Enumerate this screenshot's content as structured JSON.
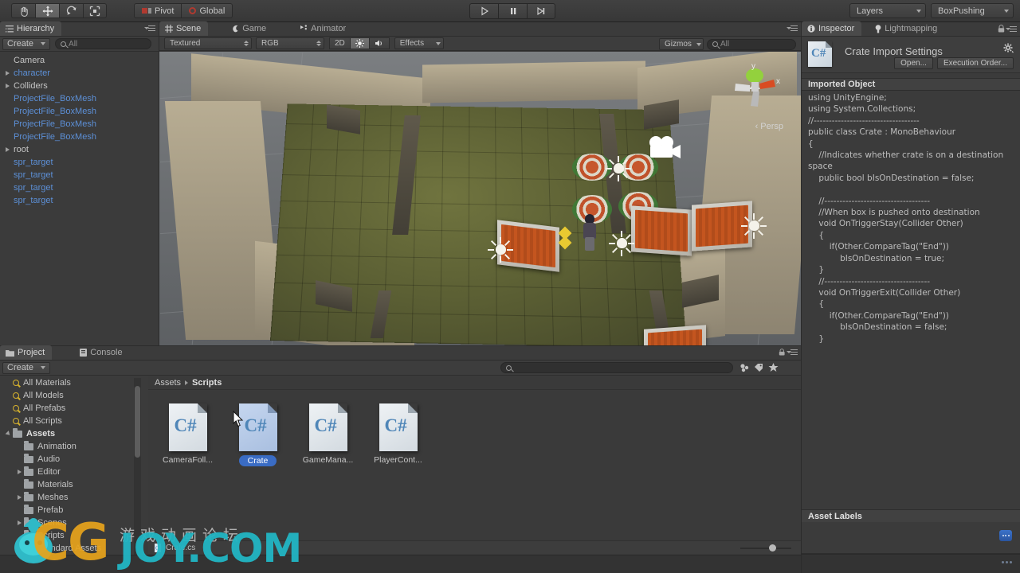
{
  "toolbar": {
    "tools": [
      {
        "name": "hand-tool",
        "icon": "hand",
        "active": false
      },
      {
        "name": "move-tool",
        "icon": "move",
        "active": true
      },
      {
        "name": "rotate-tool",
        "icon": "rotate",
        "active": false
      },
      {
        "name": "scale-tool",
        "icon": "scale",
        "active": false
      }
    ],
    "pivot_label": "Pivot",
    "global_label": "Global",
    "play_label": "play",
    "pause_label": "pause",
    "step_label": "step",
    "layers_label": "Layers",
    "layout_label": "BoxPushing"
  },
  "hierarchy": {
    "tab_label": "Hierarchy",
    "create_label": "Create",
    "search_placeholder": "All",
    "items": [
      {
        "label": "Camera",
        "expandable": false,
        "color": "gray"
      },
      {
        "label": "character",
        "expandable": true,
        "color": "blue"
      },
      {
        "label": "Colliders",
        "expandable": true,
        "color": "gray"
      },
      {
        "label": "ProjectFile_BoxMesh",
        "expandable": false,
        "color": "blue"
      },
      {
        "label": "ProjectFile_BoxMesh",
        "expandable": false,
        "color": "blue"
      },
      {
        "label": "ProjectFile_BoxMesh",
        "expandable": false,
        "color": "blue"
      },
      {
        "label": "ProjectFile_BoxMesh",
        "expandable": false,
        "color": "blue"
      },
      {
        "label": "root",
        "expandable": true,
        "color": "gray"
      },
      {
        "label": "spr_target",
        "expandable": false,
        "color": "blue"
      },
      {
        "label": "spr_target",
        "expandable": false,
        "color": "blue"
      },
      {
        "label": "spr_target",
        "expandable": false,
        "color": "blue"
      },
      {
        "label": "spr_target",
        "expandable": false,
        "color": "blue"
      }
    ]
  },
  "scene": {
    "tabs": [
      {
        "label": "Scene",
        "icon": "grid-icon",
        "active": true
      },
      {
        "label": "Game",
        "icon": "gamepad-icon",
        "active": false
      },
      {
        "label": "Animator",
        "icon": "animator-icon",
        "active": false
      }
    ],
    "draw_mode": "Textured",
    "color_mode": "RGB",
    "mode_2d": "2D",
    "lighting_icon": "sun-icon",
    "audio_icon": "speaker-icon",
    "effects_label": "Effects",
    "gizmos_label": "Gizmos",
    "gizmo_search_placeholder": "All",
    "axis_x": "x",
    "axis_y": "y",
    "projection_label": "Persp"
  },
  "inspector": {
    "tabs": [
      {
        "label": "Inspector",
        "icon": "info-icon",
        "active": true
      },
      {
        "label": "Lightmapping",
        "icon": "bulb-icon",
        "active": false
      }
    ],
    "title": "Crate Import Settings",
    "open_label": "Open...",
    "execution_order_label": "Execution Order...",
    "imported_object_label": "Imported Object",
    "source_code": "using UnityEngine;\nusing System.Collections;\n//-----------------------------------\npublic class Crate : MonoBehaviour\n{\n    //Indicates whether crate is on a destination space\n    public bool bIsOnDestination = false;\n\n    //-----------------------------------\n    //When box is pushed onto destination\n    void OnTriggerStay(Collider Other)\n    {\n        if(Other.CompareTag(\"End\"))\n            bIsOnDestination = true;\n    }\n    //-----------------------------------\n    void OnTriggerExit(Collider Other)\n    {\n        if(Other.CompareTag(\"End\"))\n            bIsOnDestination = false;\n    }\n    //-----------------------------------\n}",
    "asset_labels_header": "Asset Labels"
  },
  "project": {
    "tabs": [
      {
        "label": "Project",
        "icon": "folder-icon",
        "active": true
      },
      {
        "label": "Console",
        "icon": "console-icon",
        "active": false
      }
    ],
    "create_label": "Create",
    "search_placeholder": "",
    "tree": [
      {
        "label": "All Materials",
        "type": "search",
        "indent": 0,
        "expandable": false,
        "bold": false
      },
      {
        "label": "All Models",
        "type": "search",
        "indent": 0,
        "expandable": false,
        "bold": false
      },
      {
        "label": "All Prefabs",
        "type": "search",
        "indent": 0,
        "expandable": false,
        "bold": false
      },
      {
        "label": "All Scripts",
        "type": "search",
        "indent": 0,
        "expandable": false,
        "bold": false
      },
      {
        "label": "Assets",
        "type": "folder",
        "indent": 0,
        "expandable": true,
        "expanded": true,
        "bold": true
      },
      {
        "label": "Animation",
        "type": "folder",
        "indent": 1,
        "expandable": false,
        "bold": false
      },
      {
        "label": "Audio",
        "type": "folder",
        "indent": 1,
        "expandable": false,
        "bold": false
      },
      {
        "label": "Editor",
        "type": "folder",
        "indent": 1,
        "expandable": true,
        "bold": false
      },
      {
        "label": "Materials",
        "type": "folder",
        "indent": 1,
        "expandable": false,
        "bold": false
      },
      {
        "label": "Meshes",
        "type": "folder",
        "indent": 1,
        "expandable": true,
        "bold": false
      },
      {
        "label": "Prefab",
        "type": "folder",
        "indent": 1,
        "expandable": false,
        "bold": false
      },
      {
        "label": "Scenes",
        "type": "folder",
        "indent": 1,
        "expandable": true,
        "bold": false
      },
      {
        "label": "Scripts",
        "type": "folder",
        "indent": 1,
        "expandable": false,
        "bold": false
      },
      {
        "label": "Standard Assets",
        "type": "folder",
        "indent": 1,
        "expandable": true,
        "bold": false
      }
    ],
    "breadcrumb": [
      "Assets",
      "Scripts"
    ],
    "assets": [
      {
        "label": "CameraFoll...",
        "icon": "csharp-script-icon",
        "selected": false
      },
      {
        "label": "Crate",
        "icon": "csharp-script-icon",
        "selected": true
      },
      {
        "label": "GameMana...",
        "icon": "csharp-script-icon",
        "selected": false
      },
      {
        "label": "PlayerCont...",
        "icon": "csharp-script-icon",
        "selected": false
      }
    ],
    "status_item": "Crate.cs"
  },
  "watermark": {
    "brand_cg": "CG",
    "brand_joy": "JOY.COM",
    "chinese": "游戏动画论坛"
  },
  "colors": {
    "accent_blue": "#3a6cc4",
    "link_blue": "#5c8fd6",
    "panel_bg": "#3b3b3b",
    "toolbar_bg": "#414141"
  }
}
